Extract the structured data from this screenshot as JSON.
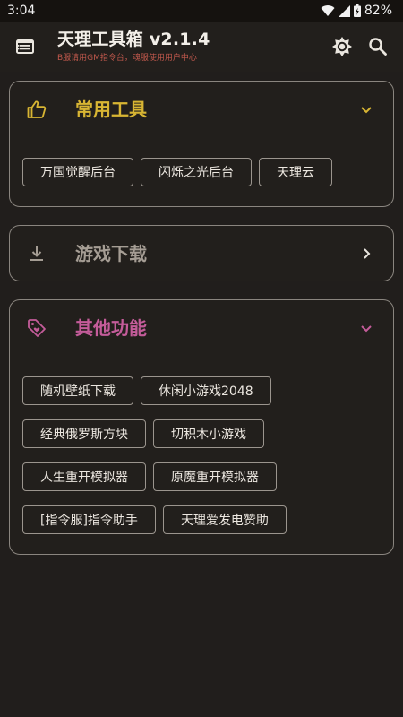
{
  "status_bar": {
    "time": "3:04",
    "battery": "82%"
  },
  "app_bar": {
    "title": "天理工具箱 v2.1.4",
    "subtitle": "B服请用GM指令台，魂服使用用户中心"
  },
  "colors": {
    "background": "#211e1c",
    "accent_gold": "#d8b533",
    "accent_grey": "#a59d94",
    "accent_pink": "#c45c9a",
    "subtitle_red": "#c0584c"
  },
  "sections": {
    "common": {
      "title": "常用工具",
      "icon": "thumb-up-icon",
      "chips": [
        "万国觉醒后台",
        "闪烁之光后台",
        "天理云"
      ]
    },
    "downloads": {
      "title": "游戏下载",
      "icon": "download-icon"
    },
    "other": {
      "title": "其他功能",
      "icon": "tag-icon",
      "chips": [
        "随机壁纸下载",
        "休闲小游戏2048",
        "经典俄罗斯方块",
        "切积木小游戏",
        "人生重开模拟器",
        "原魔重开模拟器",
        "[指令服]指令助手",
        "天理爱发电赞助"
      ]
    }
  }
}
